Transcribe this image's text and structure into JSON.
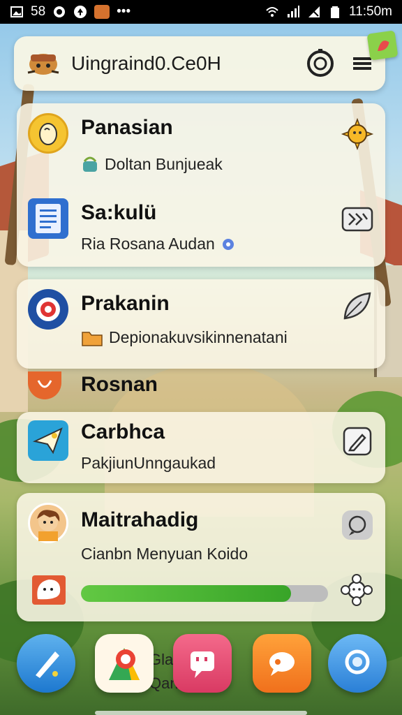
{
  "status_bar": {
    "left_text": "58",
    "time": "11:50m"
  },
  "header": {
    "title": "Uingraind0.Ce0H"
  },
  "cards": [
    {
      "title": "Panasian",
      "subtitle": "Doltan Bunjueak",
      "icon": "potato-character-icon",
      "action_icon": "sun-character-icon",
      "bg": "#f5c431"
    },
    {
      "title": "Sa:kulü",
      "subtitle": "Ria Rosana Audan",
      "icon": "document-icon",
      "action_icon": "forward-icon",
      "bg": "#2f6fcf"
    },
    {
      "title": "Prakanin",
      "subtitle": "Depionakuvsikinnenatani",
      "icon": "target-icon",
      "action_icon": "leaf-icon",
      "bg": "#1f4fa3"
    },
    {
      "title": "Rosnan",
      "icon": "shield-icon",
      "bg": "#e5662c"
    },
    {
      "title": "Carbhca",
      "subtitle": "PakjiunUnngaukad",
      "icon": "paper-plane-icon",
      "action_icon": "edit-icon",
      "bg": "#2aa3d8"
    },
    {
      "title": "Maitrahadig",
      "subtitle": "Cianbn Menyuan Koido",
      "icon": "avatar-icon",
      "action_icon": "chat-bubble-icon",
      "bg": "#f3c58b",
      "progress": 0.85
    }
  ],
  "dock": {
    "label_line1": "Gla",
    "label_line2": "Qan",
    "apps": [
      "pen-app-icon",
      "maps-app-icon",
      "chat-app-icon",
      "message-app-icon",
      "search-app-icon"
    ]
  },
  "colors": {
    "accent_green": "#4cbc37",
    "card_bg": "#faf6e6"
  }
}
